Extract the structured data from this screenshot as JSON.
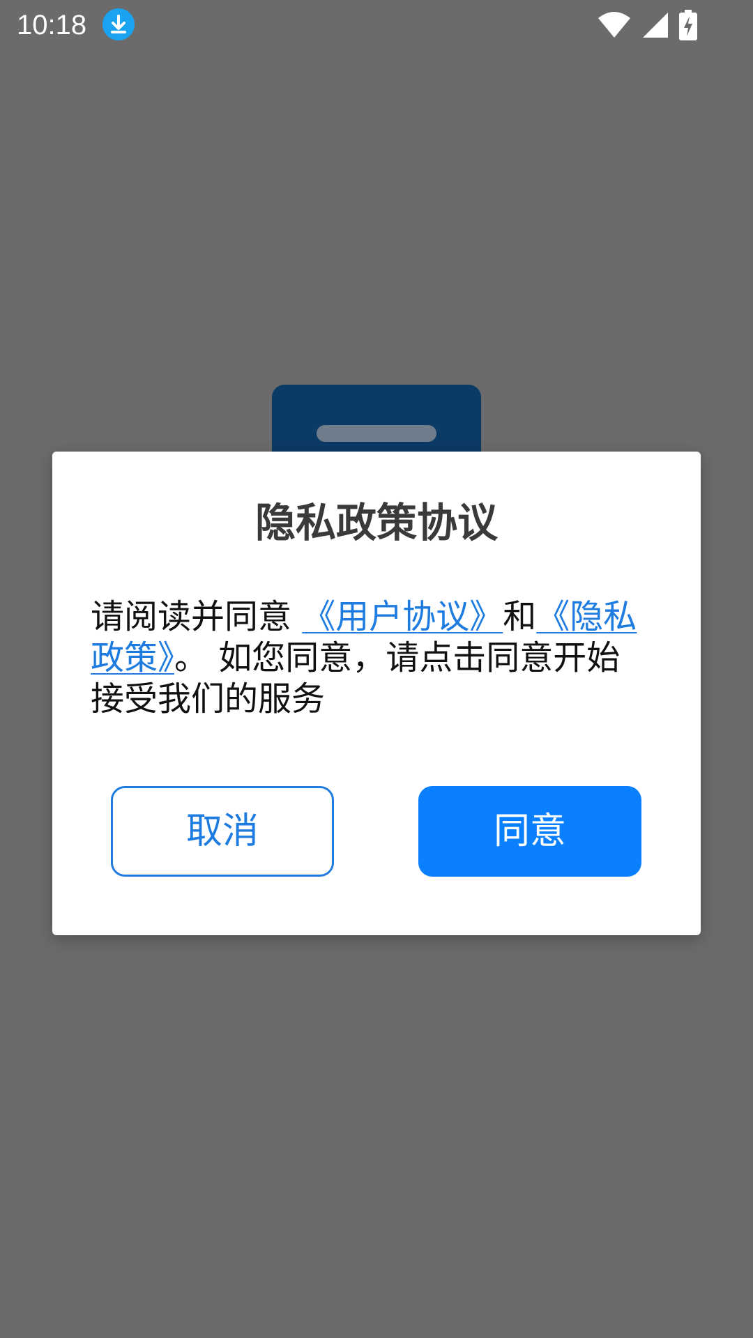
{
  "status_bar": {
    "time": "10:18",
    "icons": [
      "download-icon",
      "wifi-icon",
      "signal-icon",
      "battery-charging-icon"
    ]
  },
  "dialog": {
    "title": "隐私政策协议",
    "body_prefix": "请阅读并同意 ",
    "user_agreement_link": "《用户协议》",
    "conjunction": "和",
    "privacy_policy_link": "《隐私政策》",
    "body_suffix": "。 如您同意，请点击同意开始接受我们的服务",
    "cancel_label": "取消",
    "agree_label": "同意"
  },
  "colors": {
    "accent": "#0a80ff",
    "link": "#1e7be0",
    "scrim": "#6b6b6b"
  }
}
